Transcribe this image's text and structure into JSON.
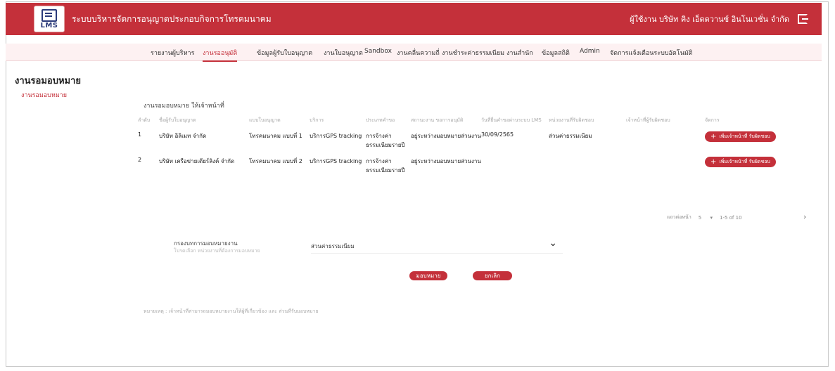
{
  "header": {
    "logo_text": "LMS",
    "app_title": "ระบบบริหารจัดการอนุญาตประกอบกิจการโทรคมนาคม",
    "user": "ผู้ใช้งาน บริษัท คิง เอ็ดดวานซ์ อินโนเวชั่น จำกัด"
  },
  "nav": [
    "รายงานผู้บริหาร",
    "งานรออนุมัติ",
    "ข้อมูลผู้รับใบอนุญาต",
    "งานใบอนุญาต",
    "Sandbox",
    "งานคลื่นความถี่",
    "งานชำระค่าธรรมเนียม",
    "งานสำนัก",
    "ข้อมูลสถิติ",
    "Admin",
    "จัดการแจ้งเตือนระบบอัตโนมัติ"
  ],
  "page": {
    "heading": "งานรอมอบหมาย",
    "breadcrumb": "งานรอมอบหมาย",
    "section_title": "งานรอมอบหมาย ให้เจ้าหน้าที่"
  },
  "table": {
    "headers": [
      "ลำดับ",
      "ชื่อผู้รับใบอนุญาต",
      "แบบใบอนุญาต",
      "บริการ",
      "ประเภทคำขอ",
      "สถานะงาน ขอการอนุมัติ",
      "วันที่ยื่นคำขอผ่านระบบ LMS",
      "หน่วยงานที่รับผิดชอบ",
      "เจ้าหน้าที่ผู้รับผิดชอบ",
      "จัดการ"
    ],
    "rows": [
      {
        "no": "1",
        "name": "บริษัท อิลิเมท จำกัด",
        "license": "โทรคมนาคม แบบที่ 1",
        "service": "บริการGPS tracking",
        "request": "การจ้างค่าธรรมเนียมรายปี",
        "status": "อยู่ระหว่างมอบหมายส่วนงาน",
        "date": "30/09/2565",
        "unit": "ส่วนค่าธรรมเนียม",
        "officer": "",
        "action": "เพิ่มเจ้าหน้าที่ รับผิดชอบ"
      },
      {
        "no": "2",
        "name": "บริษัท เครือข่ายเดียร์ลิงค์ จำกัด",
        "license": "โทรคมนาคม แบบที่ 2",
        "service": "บริการGPS tracking",
        "request": "การจ้างค่าธรรมเนียมรายปี",
        "status": "อยู่ระหว่างมอบหมายส่วนงาน",
        "date": "",
        "unit": "",
        "officer": "",
        "action": "เพิ่มเจ้าหน้าที่ รับผิดชอบ"
      }
    ]
  },
  "pager": {
    "rows_label": "แถวต่อหน้า",
    "rows_value": "5",
    "range": "1-5 of 10"
  },
  "form": {
    "label": "กรองบทการมอบหมายงาน",
    "sub": "โปรดเลือก หน่วยงานที่ต้องการมอบหมาย",
    "select_value": "ส่วนค่าธรรมเนียม"
  },
  "buttons": {
    "assign": "มอบหมาย",
    "cancel": "ยกเลิก"
  },
  "note": "หมายเหตุ : เจ้าหน้าที่สามารถมอบหมายงานให้ผู้ที่เกี่ยวข้อง และ ส่วนที่รับมอบหมาย",
  "colors": {
    "primary": "#c4303a",
    "nav_bg": "#fdf1f2"
  }
}
